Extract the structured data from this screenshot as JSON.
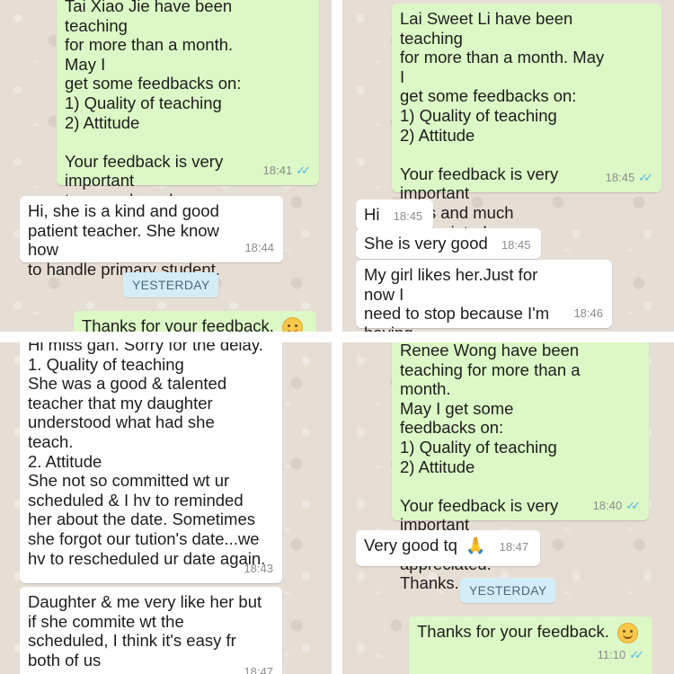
{
  "panel1": {
    "request": {
      "text": "Tai Xiao Jie have been teaching\nfor more than a month. May I\nget some feedbacks on:\n1) Quality of teaching\n2) Attitude\n\nYour feedback is very important\nto us and much appreciated.\nThanks.",
      "time": "18:41",
      "ticks": "✓✓"
    },
    "reply": {
      "text": "Hi, she is a kind and good\npatient teacher. She know how\nto handle primary student.",
      "time": "18:44"
    },
    "date_label": "YESTERDAY",
    "thanks": {
      "text": "Thanks for your feedback.",
      "emoji": "smiling-face"
    }
  },
  "panel2": {
    "request": {
      "text": "Lai Sweet Li have been teaching\nfor more than a month. May I\nget some feedbacks on:\n1) Quality of teaching\n2) Attitude\n\nYour feedback is very important\nto us and much appreciated.\nThanks.",
      "time": "18:45",
      "ticks": "✓✓"
    },
    "replies": [
      {
        "text": "Hi",
        "time": "18:45"
      },
      {
        "text": "She is very good",
        "time": "18:45"
      },
      {
        "text": "My girl likes her.Just for now I\nneed to stop because I'm having\nsome problem at home.",
        "time": "18:46"
      }
    ]
  },
  "panel3": {
    "reply1": {
      "text": "Hi miss gan. Sorry for the delay.\n1. Quality of teaching\nShe was a good & talented\nteacher that my daughter\nunderstood what had she\nteach.\n2. Attitude\nShe not so committed wt ur\nscheduled & I hv to reminded\nher about the date.  Sometimes\nshe forgot our tution's date...we\nhv to rescheduled ur date again.",
      "time": "18:43"
    },
    "reply2": {
      "text": "Daughter & me very like her but\nif she commite wt the\nscheduled, I think it's easy fr\nboth of us",
      "time": "18:47"
    }
  },
  "panel4": {
    "request": {
      "text": "Renee Wong have been\nteaching for more than a month.\nMay I get some feedbacks on:\n1) Quality of teaching\n2) Attitude\n\nYour feedback is very important\nto us and much appreciated.\nThanks.",
      "time": "18:40",
      "ticks": "✓✓"
    },
    "reply": {
      "text": "Very good tq",
      "emoji": "folded-hands",
      "time": "18:47"
    },
    "date_label": "YESTERDAY",
    "thanks": {
      "text": "Thanks for your feedback.",
      "emoji": "smiling-face",
      "time": "11:10",
      "ticks": "✓✓"
    }
  },
  "colors": {
    "outgoing": "#dcf8c6",
    "incoming": "#ffffff",
    "read_ticks": "#4fb8e6",
    "date_pill": "#d4ecf7"
  }
}
